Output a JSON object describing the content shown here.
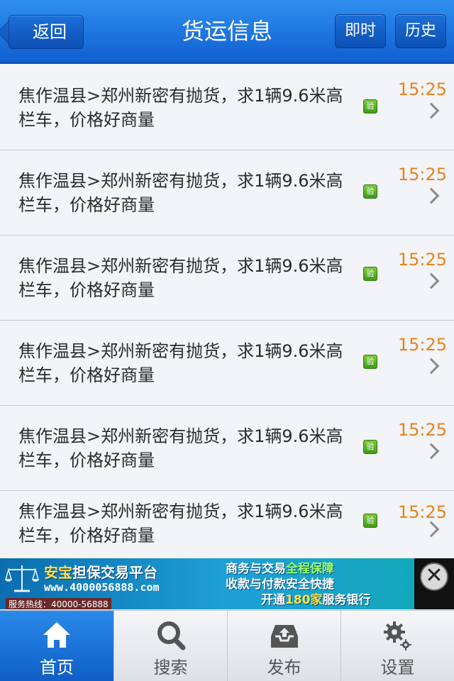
{
  "header": {
    "title": "货运信息",
    "back_label": "返回",
    "btn_now": "即时",
    "btn_history": "历史"
  },
  "list": [
    {
      "text": "焦作温县>郑州新密有抛货，求1辆9.6米高栏车，价格好商量",
      "badge": "验",
      "time": "15:25"
    },
    {
      "text": "焦作温县>郑州新密有抛货，求1辆9.6米高栏车，价格好商量",
      "badge": "验",
      "time": "15:25"
    },
    {
      "text": "焦作温县>郑州新密有抛货，求1辆9.6米高栏车，价格好商量",
      "badge": "验",
      "time": "15:25"
    },
    {
      "text": "焦作温县>郑州新密有抛货，求1辆9.6米高栏车，价格好商量",
      "badge": "验",
      "time": "15:25"
    },
    {
      "text": "焦作温县>郑州新密有抛货，求1辆9.6米高栏车，价格好商量",
      "badge": "验",
      "time": "15:25"
    },
    {
      "text": "焦作温县>郑州新密有抛货，求1辆9.6米高栏车，价格好商量",
      "badge": "验",
      "time": "15:25"
    }
  ],
  "ad": {
    "brand_a": "安宝",
    "brand_b": "担保交易平台",
    "url": "www.4000056888.com",
    "hotline": "服务热线：40000-56888",
    "line1_a": "商务与交易",
    "line1_b": "全程保障",
    "line2": "收款与付款安全快捷",
    "line3_a": "开通",
    "line3_b": "180家",
    "line3_c": "服务银行",
    "close": "✕"
  },
  "tabs": {
    "home": "首页",
    "search": "搜索",
    "publish": "发布",
    "settings": "设置"
  },
  "colors": {
    "header_blue": "#1a73e0",
    "time_orange": "#e6821e",
    "badge_green": "#4fa820"
  }
}
